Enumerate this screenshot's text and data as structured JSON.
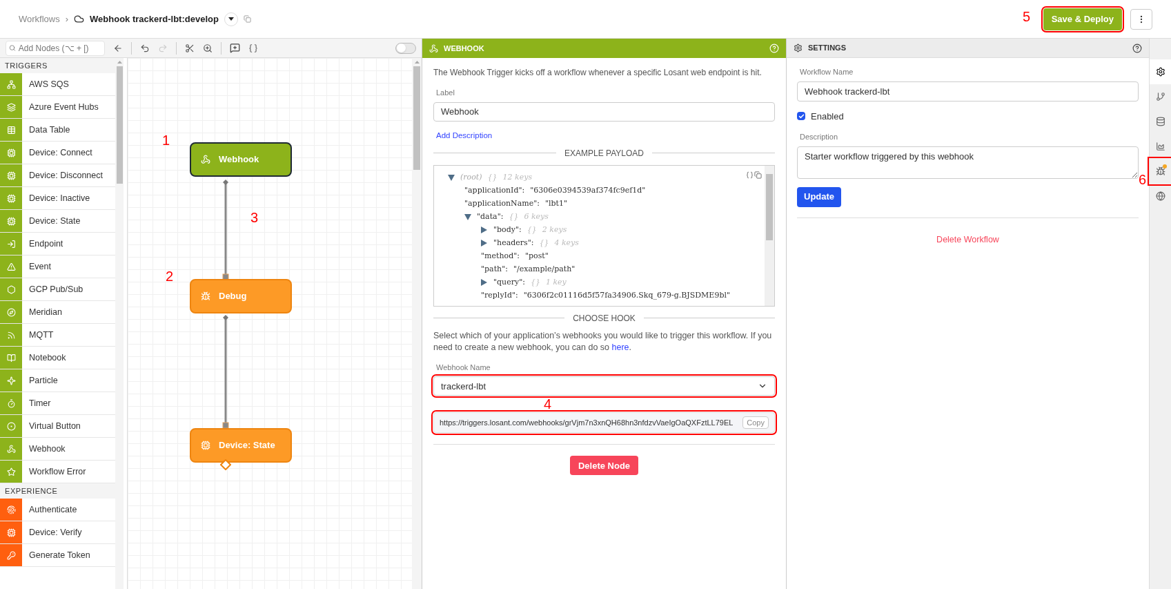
{
  "breadcrumb": {
    "parent": "Workflows",
    "separator": "›",
    "title": "Webhook trackerd-lbt:develop"
  },
  "header": {
    "save_button": {
      "label": "Save & Deploy",
      "highlighted": true
    }
  },
  "toolbar": {
    "search": {
      "placeholder": "Add Nodes (⌥ + [)"
    },
    "debug_toggle": {
      "on": false
    }
  },
  "palette": [
    {
      "heading": "TRIGGERS",
      "color": "#8db31b",
      "items": [
        "AWS SQS",
        "Azure Event Hubs",
        "Data Table",
        "Device: Connect",
        "Device: Disconnect",
        "Device: Inactive",
        "Device: State",
        "Endpoint",
        "Event",
        "GCP Pub/Sub",
        "Meridian",
        "MQTT",
        "Notebook",
        "Particle",
        "Timer",
        "Virtual Button",
        "Webhook",
        "Workflow Error"
      ]
    },
    {
      "heading": "EXPERIENCE",
      "color": "#ff5f0f",
      "items": [
        "Authenticate",
        "Device: Verify",
        "Generate Token"
      ]
    }
  ],
  "canvas": {
    "nodes": [
      {
        "label": "Webhook",
        "kind": "trigger",
        "selected": true
      },
      {
        "label": "Debug",
        "kind": "debug",
        "selected": false
      },
      {
        "label": "Device: State",
        "kind": "device",
        "selected": false
      }
    ]
  },
  "node_panel": {
    "title": "WEBHOOK",
    "description": "The Webhook Trigger kicks off a workflow whenever a specific Losant web endpoint is hit.",
    "label_field": {
      "label": "Label",
      "value": "Webhook"
    },
    "add_description": "Add Description",
    "payload_heading": "EXAMPLE PAYLOAD",
    "payload": [
      {
        "key": "(root)",
        "brace": "{}",
        "count": "12 keys",
        "expanded": true,
        "children": [
          {
            "key": "\"applicationId\":",
            "value": "\"6306e0394539af374fc9ef1d\""
          },
          {
            "key": "\"applicationName\":",
            "value": "\"lbt1\""
          },
          {
            "key": "\"data\":",
            "brace": "{}",
            "count": "6 keys",
            "expanded": true,
            "children": [
              {
                "key": "\"body\":",
                "brace": "{}",
                "count": "2 keys",
                "expanded": false
              },
              {
                "key": "\"headers\":",
                "brace": "{}",
                "count": "4 keys",
                "expanded": false
              },
              {
                "key": "\"method\":",
                "value": "\"post\""
              },
              {
                "key": "\"path\":",
                "value": "\"/example/path\""
              },
              {
                "key": "\"query\":",
                "brace": "{}",
                "count": "1 key",
                "expanded": false
              },
              {
                "key": "\"replyId\":",
                "value": "\"6306f2c01116d5f57fa34906.Skq_679-g.BJSDME9bl\""
              }
            ]
          }
        ]
      }
    ],
    "hook_heading": "CHOOSE HOOK",
    "hook_text_before": "Select which of your application’s webhooks you would like to trigger this workflow. If you need to create a new webhook, you can do so ",
    "hook_link": "here",
    "hook_text_after": ".",
    "webhook_select": {
      "label": "Webhook Name",
      "value": "trackerd-lbt",
      "highlighted": true
    },
    "url_field": {
      "value": "https://triggers.losant.com/webhooks/grVjm7n3xnQH68hn3nfdzvVaeIgOaQXFztLL79EL",
      "copy": "Copy",
      "highlighted": true
    },
    "delete_button": "Delete Node"
  },
  "settings_panel": {
    "title": "SETTINGS",
    "name_field": {
      "label": "Workflow Name",
      "value": "Webhook trackerd-lbt"
    },
    "enabled": {
      "label": "Enabled",
      "checked": true
    },
    "description_field": {
      "label": "Description",
      "value": "Starter workflow triggered by this webhook"
    },
    "update_button": "Update",
    "delete_link": "Delete Workflow"
  },
  "rail": [
    {
      "selected": true,
      "badge": false,
      "highlighted": false
    },
    {
      "selected": false,
      "badge": false,
      "highlighted": false
    },
    {
      "selected": false,
      "badge": false,
      "highlighted": false
    },
    {
      "selected": false,
      "badge": false,
      "highlighted": false
    },
    {
      "selected": false,
      "badge": true,
      "highlighted": true
    },
    {
      "selected": false,
      "badge": false,
      "highlighted": false
    }
  ],
  "annotations": [
    "1",
    "2",
    "3",
    "4",
    "5",
    "6"
  ]
}
